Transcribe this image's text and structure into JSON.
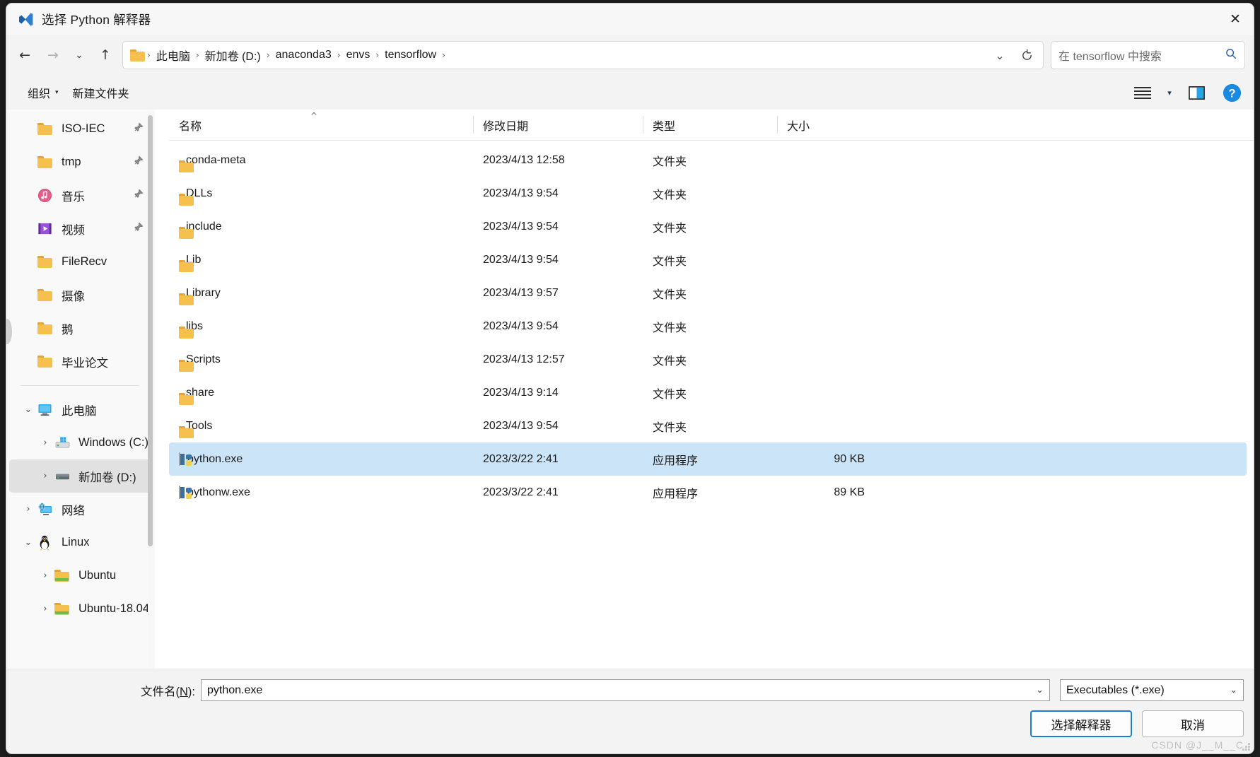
{
  "window": {
    "title": "选择 Python 解释器",
    "app_icon": "vscode-icon",
    "close_label": "✕"
  },
  "nav": {
    "back": "←",
    "forward": "→",
    "recent": "⌄",
    "up": "↑"
  },
  "address": {
    "folder_icon": "folder-icon",
    "crumbs": [
      "此电脑",
      "新加卷 (D:)",
      "anaconda3",
      "envs",
      "tensorflow"
    ],
    "separator": "›",
    "trailing_separator": "›",
    "history_icon": "⌄",
    "refresh_icon": "⟳"
  },
  "search": {
    "placeholder": "在 tensorflow 中搜索",
    "icon": "search-icon",
    "icon_glyph": "⌕"
  },
  "commandbar": {
    "organize": "组织",
    "organize_caret": "▾",
    "new_folder": "新建文件夹",
    "view_caret": "▾",
    "view_icon": "list-view-icon",
    "preview_icon": "preview-pane-icon",
    "help_icon": "help-icon",
    "help_glyph": "?"
  },
  "sidebar": {
    "items": [
      {
        "label": "ISO-IEC",
        "icon": "folder-icon",
        "indent": 1,
        "chevron": "",
        "pinned": true,
        "selected": false
      },
      {
        "label": "tmp",
        "icon": "folder-icon",
        "indent": 1,
        "chevron": "",
        "pinned": true,
        "selected": false
      },
      {
        "label": "音乐",
        "icon": "music-icon",
        "indent": 1,
        "chevron": "",
        "pinned": true,
        "selected": false
      },
      {
        "label": "视频",
        "icon": "video-icon",
        "indent": 1,
        "chevron": "",
        "pinned": true,
        "selected": false
      },
      {
        "label": "FileRecv",
        "icon": "folder-icon",
        "indent": 1,
        "chevron": "",
        "pinned": false,
        "selected": false
      },
      {
        "label": "摄像",
        "icon": "folder-icon",
        "indent": 1,
        "chevron": "",
        "pinned": false,
        "selected": false
      },
      {
        "label": "鹅",
        "icon": "folder-icon",
        "indent": 1,
        "chevron": "",
        "pinned": false,
        "selected": false
      },
      {
        "label": "毕业论文",
        "icon": "folder-icon",
        "indent": 1,
        "chevron": "",
        "pinned": false,
        "selected": false
      }
    ],
    "items2": [
      {
        "label": "此电脑",
        "icon": "this-pc-icon",
        "indent": 0,
        "chevron": "⌄",
        "pinned": false,
        "selected": false
      },
      {
        "label": "Windows (C:)",
        "icon": "windows-drive-icon",
        "indent": 1,
        "chevron": "›",
        "pinned": false,
        "selected": false
      },
      {
        "label": "新加卷 (D:)",
        "icon": "drive-icon",
        "indent": 1,
        "chevron": "›",
        "pinned": false,
        "selected": true
      },
      {
        "label": "网络",
        "icon": "network-icon",
        "indent": 0,
        "chevron": "›",
        "pinned": false,
        "selected": false
      },
      {
        "label": "Linux",
        "icon": "linux-penguin-icon",
        "indent": 0,
        "chevron": "⌄",
        "pinned": false,
        "selected": false
      },
      {
        "label": "Ubuntu",
        "icon": "linux-folder-icon",
        "indent": 1,
        "chevron": "›",
        "pinned": false,
        "selected": false
      },
      {
        "label": "Ubuntu-18.04",
        "icon": "linux-folder-icon",
        "indent": 1,
        "chevron": "›",
        "pinned": false,
        "selected": false
      }
    ]
  },
  "filelist": {
    "columns": [
      "名称",
      "修改日期",
      "类型",
      "大小"
    ],
    "sort_column": "名称",
    "sort_caret": "^",
    "rows": [
      {
        "name": "conda-meta",
        "date": "2023/4/13 12:58",
        "type": "文件夹",
        "size": "",
        "icon": "folder-icon",
        "selected": false
      },
      {
        "name": "DLLs",
        "date": "2023/4/13 9:54",
        "type": "文件夹",
        "size": "",
        "icon": "folder-icon",
        "selected": false
      },
      {
        "name": "include",
        "date": "2023/4/13 9:54",
        "type": "文件夹",
        "size": "",
        "icon": "folder-icon",
        "selected": false
      },
      {
        "name": "Lib",
        "date": "2023/4/13 9:54",
        "type": "文件夹",
        "size": "",
        "icon": "folder-icon",
        "selected": false
      },
      {
        "name": "Library",
        "date": "2023/4/13 9:57",
        "type": "文件夹",
        "size": "",
        "icon": "folder-icon",
        "selected": false
      },
      {
        "name": "libs",
        "date": "2023/4/13 9:54",
        "type": "文件夹",
        "size": "",
        "icon": "folder-icon",
        "selected": false
      },
      {
        "name": "Scripts",
        "date": "2023/4/13 12:57",
        "type": "文件夹",
        "size": "",
        "icon": "folder-icon",
        "selected": false
      },
      {
        "name": "share",
        "date": "2023/4/13 9:14",
        "type": "文件夹",
        "size": "",
        "icon": "folder-icon",
        "selected": false
      },
      {
        "name": "Tools",
        "date": "2023/4/13 9:54",
        "type": "文件夹",
        "size": "",
        "icon": "folder-icon",
        "selected": false
      },
      {
        "name": "python.exe",
        "date": "2023/3/22 2:41",
        "type": "应用程序",
        "size": "90 KB",
        "icon": "python-exe-icon",
        "selected": true
      },
      {
        "name": "pythonw.exe",
        "date": "2023/3/22 2:41",
        "type": "应用程序",
        "size": "89 KB",
        "icon": "python-exe-icon",
        "selected": false
      }
    ]
  },
  "footer": {
    "filename_label_prefix": "文件名(",
    "filename_label_key": "N",
    "filename_label_suffix": "):",
    "filename_value": "python.exe",
    "dropdown_caret": "⌄",
    "filter_value": "Executables (*.exe)",
    "confirm_button": "选择解释器",
    "cancel_button": "取消",
    "watermark": "CSDN @J__M__C"
  },
  "colors": {
    "accent": "#1a7fd4",
    "selection": "#cce4f7",
    "sidebar_selection": "#e1e1e1",
    "folder": "#f5c04e",
    "chrome": "#f3f3f3"
  }
}
